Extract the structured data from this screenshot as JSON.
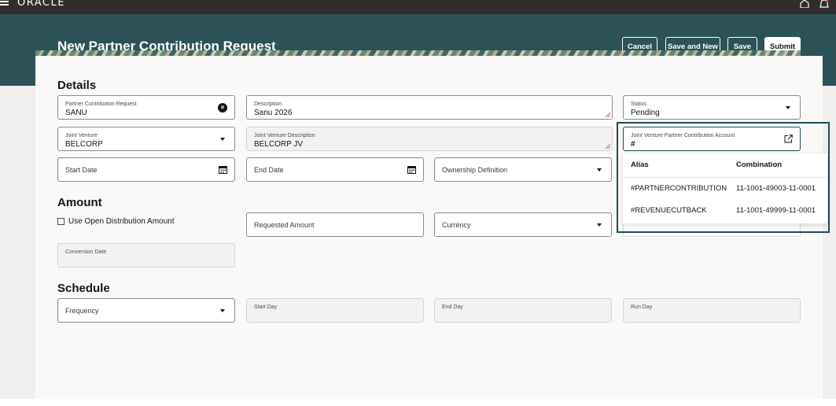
{
  "topbar": {
    "brand": "ORACLE"
  },
  "header": {
    "title": "New Partner Contribution Request",
    "buttons": {
      "cancel": "Cancel",
      "save_and_new": "Save and New",
      "save": "Save",
      "submit": "Submit"
    }
  },
  "sections": {
    "details": "Details",
    "amount": "Amount",
    "schedule": "Schedule"
  },
  "details": {
    "request": {
      "label": "Partner Contribution Request",
      "value": "SANU"
    },
    "description": {
      "label": "Description",
      "value": "Sanu 2026"
    },
    "status": {
      "label": "Status",
      "value": "Pending"
    },
    "joint_venture": {
      "label": "Joint Venture",
      "value": "BELCORP"
    },
    "jv_description": {
      "label": "Joint Venture Description",
      "value": "BELCORP JV"
    },
    "account": {
      "label": "Joint Venture Partner Contribution Account",
      "value": "#"
    },
    "start_date": {
      "placeholder": "Start Date"
    },
    "end_date": {
      "placeholder": "End Date"
    },
    "ownership": {
      "placeholder": "Ownership Definition"
    }
  },
  "amount": {
    "use_open_label": "Use Open Distribution Amount",
    "requested_amount": {
      "placeholder": "Requested Amount"
    },
    "currency": {
      "placeholder": "Currency"
    },
    "conversion_date": {
      "label": "Conversion Date"
    }
  },
  "schedule": {
    "frequency": {
      "placeholder": "Frequency"
    },
    "start_day": {
      "label": "Start Day"
    },
    "end_day": {
      "label": "End Day"
    },
    "run_day": {
      "label": "Run Day"
    }
  },
  "account_popup": {
    "columns": [
      "Alias",
      "Combination"
    ],
    "rows": [
      {
        "alias": "#PARTNERCONTRIBUTION",
        "combination": "11-1001-49003-11-0001"
      },
      {
        "alias": "#REVENUECUTBACK",
        "combination": "11-1001-49999-11-0001"
      }
    ]
  },
  "colors": {
    "banner": "#2c5258",
    "topbar": "#312d2a",
    "focus_border": "#1c4c5a"
  },
  "icons": [
    "menu-icon",
    "home-icon",
    "bell-icon",
    "clear-icon",
    "calendar-icon",
    "chevron-down-icon",
    "external-link-icon"
  ]
}
